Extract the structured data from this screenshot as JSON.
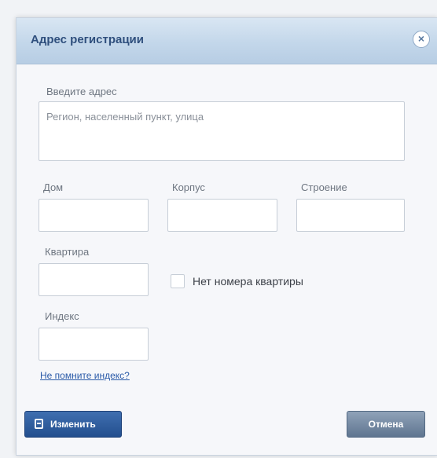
{
  "dialog": {
    "title": "Адрес регистрации",
    "close_glyph": "×"
  },
  "form": {
    "address": {
      "label": "Введите адрес",
      "placeholder": "Регион, населенный пункт, улица"
    },
    "house": {
      "label": "Дом",
      "value": ""
    },
    "building": {
      "label": "Корпус",
      "value": ""
    },
    "structure": {
      "label": "Строение",
      "value": ""
    },
    "apartment": {
      "label": "Квартира",
      "value": ""
    },
    "no_apartment": {
      "label": "Нет номера квартиры",
      "checked": false
    },
    "index": {
      "label": "Индекс",
      "value": ""
    },
    "index_link": "Не помните индекс?"
  },
  "actions": {
    "change_label": "Изменить",
    "cancel_label": "Отмена"
  },
  "icons": {
    "close": "close-icon",
    "change": "edit-icon"
  }
}
